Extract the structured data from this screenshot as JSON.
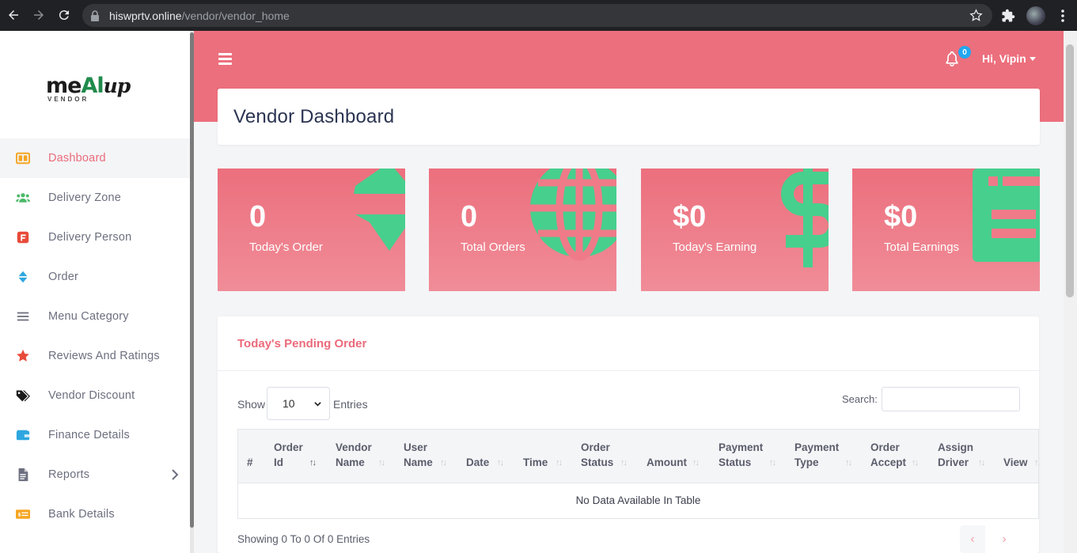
{
  "browser": {
    "url_host": "hiswprtv.online",
    "url_path": "/vendor/vendor_home"
  },
  "sidebar": {
    "logo_main": "meAlup",
    "logo_sub": "VENDOR",
    "items": [
      {
        "label": "Dashboard",
        "icon": "dashboard-icon",
        "active": true
      },
      {
        "label": "Delivery Zone",
        "icon": "users-icon"
      },
      {
        "label": "Delivery Person",
        "icon": "delivery-person-icon"
      },
      {
        "label": "Order",
        "icon": "sort-icon"
      },
      {
        "label": "Menu Category",
        "icon": "list-icon"
      },
      {
        "label": "Reviews And Ratings",
        "icon": "star-icon"
      },
      {
        "label": "Vendor Discount",
        "icon": "tags-icon"
      },
      {
        "label": "Finance Details",
        "icon": "wallet-icon"
      },
      {
        "label": "Reports",
        "icon": "file-icon",
        "has_submenu": true
      },
      {
        "label": "Bank Details",
        "icon": "money-check-icon"
      }
    ]
  },
  "header": {
    "notification_count": "0",
    "user_greeting": "Hi, Vipin"
  },
  "page": {
    "title": "Vendor Dashboard"
  },
  "stats": [
    {
      "value": "0",
      "label": "Today's Order",
      "icon": "sort-icon"
    },
    {
      "value": "0",
      "label": "Total Orders",
      "icon": "globe-icon"
    },
    {
      "value": "$0",
      "label": "Today's Earning",
      "icon": "dollar-icon"
    },
    {
      "value": "$0",
      "label": "Total Earnings",
      "icon": "receipt-icon"
    }
  ],
  "orders": {
    "title": "Today's Pending Order",
    "show_label": "Show",
    "entries_value": "10",
    "entries_label": "Entries",
    "search_label": "Search:",
    "search_value": "",
    "columns": [
      [
        "#"
      ],
      [
        "Order",
        "Id"
      ],
      [
        "Vendor",
        "Name"
      ],
      [
        "User",
        "Name"
      ],
      [
        "Date"
      ],
      [
        "Time"
      ],
      [
        "Order",
        "Status"
      ],
      [
        "Amount"
      ],
      [
        "Payment",
        "Status"
      ],
      [
        "Payment",
        "Type"
      ],
      [
        "Order",
        "Accept"
      ],
      [
        "Assign",
        "Driver"
      ],
      [
        "View"
      ]
    ],
    "empty_message": "No Data Available In Table",
    "footer": "Showing 0 To 0 Of 0 Entries",
    "prev_label": "‹",
    "next_label": "›"
  },
  "colors": {
    "brand": "#ec6f7d",
    "icon_green": "#44cc8c",
    "badge": "#22a7f0"
  }
}
